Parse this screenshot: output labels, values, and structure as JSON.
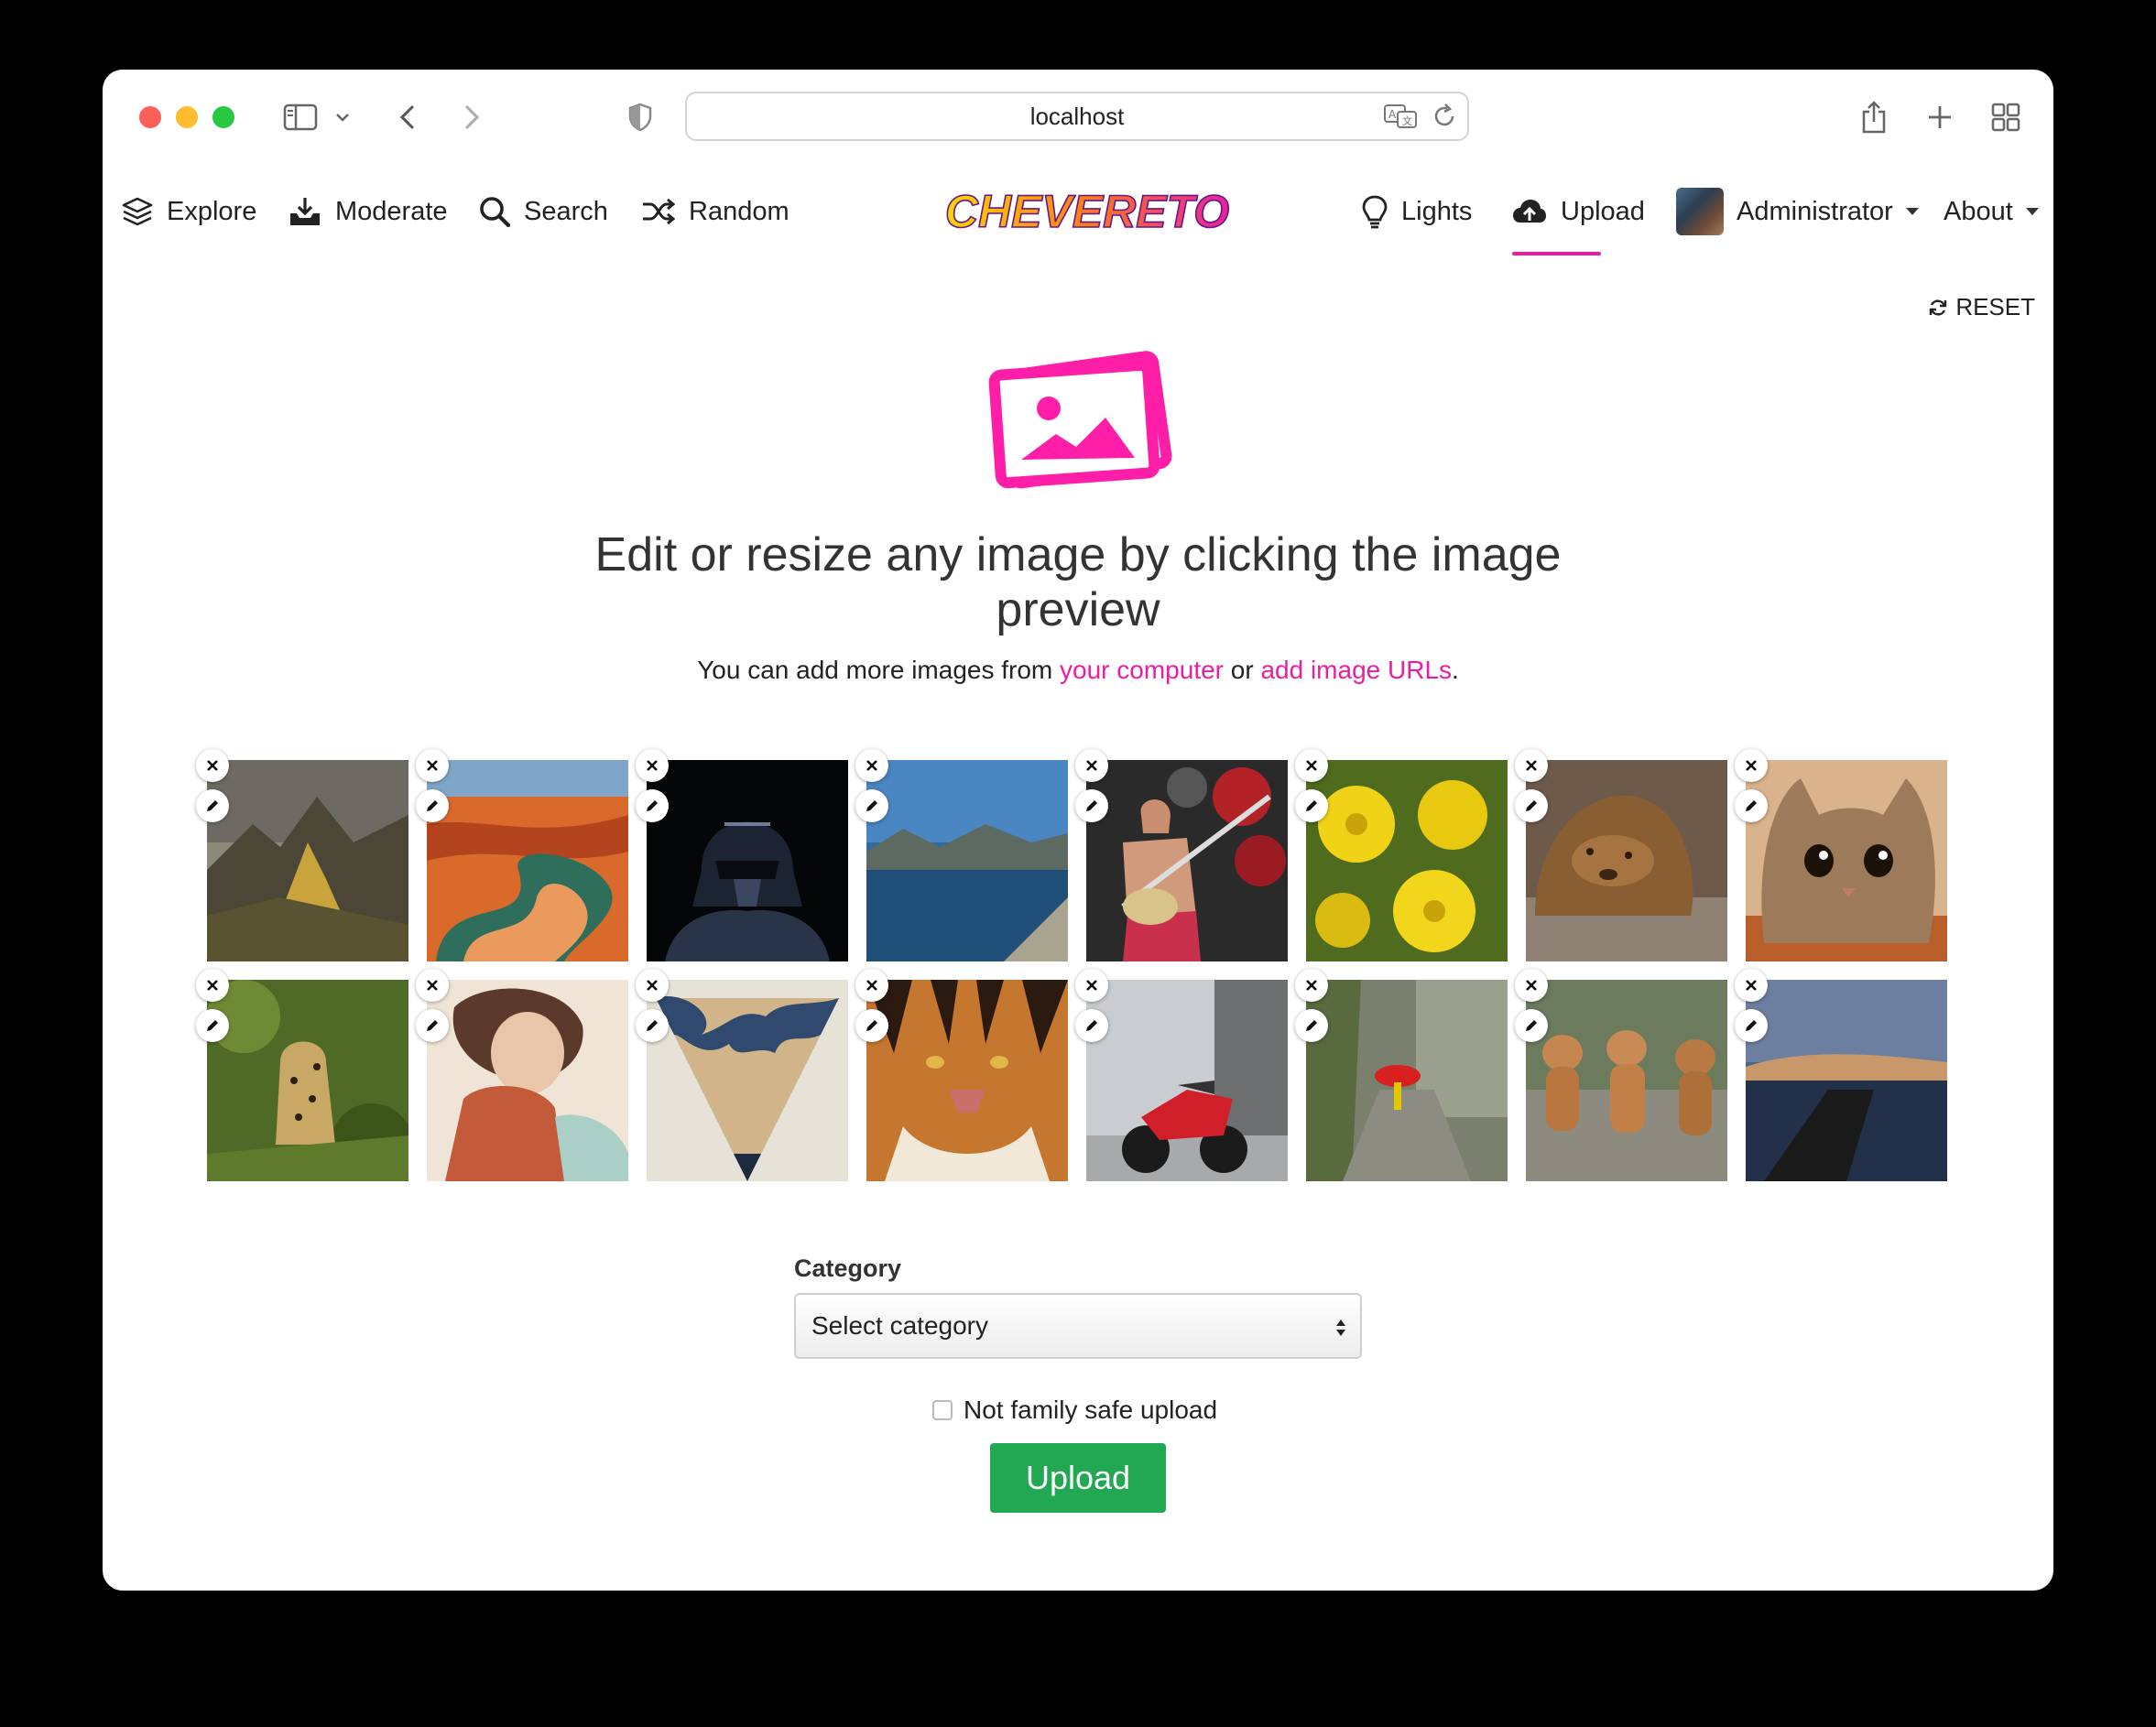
{
  "browser": {
    "url": "localhost",
    "icons": [
      "sidebar-icon",
      "chevron-down-icon",
      "back-icon",
      "forward-icon",
      "shield-icon",
      "translate-icon",
      "reload-icon",
      "share-icon",
      "new-tab-icon",
      "tab-overview-icon"
    ]
  },
  "nav": {
    "explore": "Explore",
    "moderate": "Moderate",
    "search": "Search",
    "random": "Random",
    "logo": "CHEVERETO",
    "lights": "Lights",
    "upload": "Upload",
    "user": "Administrator",
    "about": "About"
  },
  "reset_label": "RESET",
  "heading": "Edit or resize any image by clicking the image preview",
  "subline": {
    "prefix": "You can add more images from ",
    "link_computer": "your computer",
    "middle": " or ",
    "link_urls": "add image URLs",
    "suffix": "."
  },
  "thumbnails": [
    {
      "subject": "mountain valley"
    },
    {
      "subject": "canyon river bend"
    },
    {
      "subject": "darth vader"
    },
    {
      "subject": "mountain lake"
    },
    {
      "subject": "bass guitarist"
    },
    {
      "subject": "yellow dandelions"
    },
    {
      "subject": "sleeping sea lion"
    },
    {
      "subject": "surprised cat"
    },
    {
      "subject": "leopard in grass"
    },
    {
      "subject": "watercolor girl"
    },
    {
      "subject": "world map pencil"
    },
    {
      "subject": "tiger face"
    },
    {
      "subject": "red motorcycle"
    },
    {
      "subject": "red umbrella stairs"
    },
    {
      "subject": "three puppies"
    },
    {
      "subject": "lake pier dusk"
    }
  ],
  "form": {
    "category_label": "Category",
    "category_value": "Select category",
    "nsfw_label": "Not family safe upload",
    "nsfw_checked": false,
    "submit_label": "Upload"
  },
  "colors": {
    "accent": "#e91ea4",
    "upload_button": "#22a752",
    "page_bg": "#000000"
  }
}
